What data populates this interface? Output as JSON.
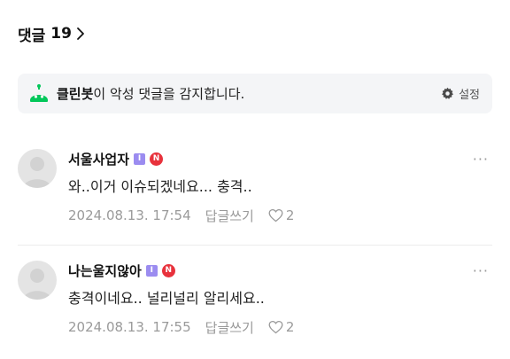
{
  "header": {
    "label": "댓글",
    "count": "19"
  },
  "cleanbot": {
    "name": "클린봇",
    "message": "이 악성 댓글을 감지합니다.",
    "settings_label": "설정"
  },
  "comments": [
    {
      "author": "서울사업자",
      "level_badge": "I",
      "n_badge": "N",
      "text": "와..이거 이슈되겠네요... 충격..",
      "date": "2024.08.13. 17:54",
      "reply_label": "답글쓰기",
      "likes": "2"
    },
    {
      "author": "나는울지않아",
      "level_badge": "I",
      "n_badge": "N",
      "text": "충격이네요.. 널리널리 알리세요..",
      "date": "2024.08.13. 17:55",
      "reply_label": "답글쓰기",
      "likes": "2"
    }
  ],
  "colors": {
    "accent_green": "#03c75a",
    "badge_purple": "#9b8cf0",
    "badge_red": "#e8323c",
    "meta_gray": "#9a9a9a"
  },
  "icons": {
    "chevron": "chevron-right-icon",
    "bot": "cleanbot-icon",
    "settings": "gear-icon",
    "more": "more-icon",
    "like": "heart-icon",
    "avatar": "default-avatar-icon"
  }
}
